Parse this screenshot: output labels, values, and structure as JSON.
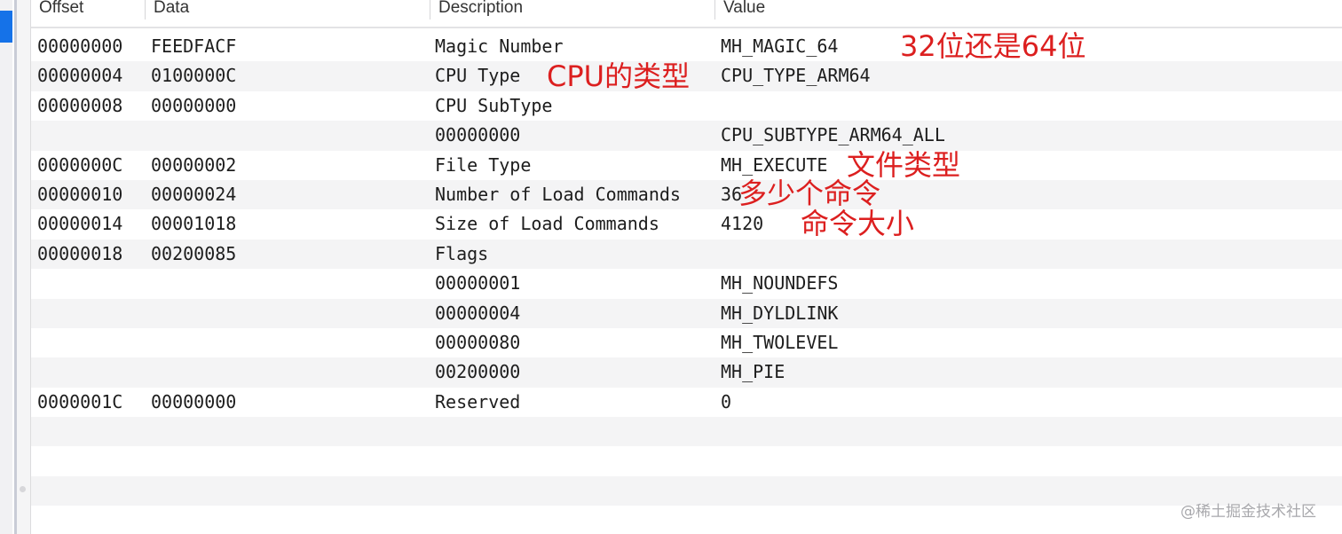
{
  "columns": {
    "offset": "Offset",
    "data": "Data",
    "description": "Description",
    "value": "Value"
  },
  "rows": [
    {
      "offset": "00000000",
      "data": "FEEDFACF",
      "description": "Magic Number",
      "value": "MH_MAGIC_64"
    },
    {
      "offset": "00000004",
      "data": "0100000C",
      "description": "CPU Type",
      "value": "CPU_TYPE_ARM64"
    },
    {
      "offset": "00000008",
      "data": "00000000",
      "description": "CPU SubType",
      "value": ""
    },
    {
      "offset": "",
      "data": "",
      "description": "00000000",
      "value": "CPU_SUBTYPE_ARM64_ALL"
    },
    {
      "offset": "0000000C",
      "data": "00000002",
      "description": "File Type",
      "value": "MH_EXECUTE"
    },
    {
      "offset": "00000010",
      "data": "00000024",
      "description": "Number of Load Commands",
      "value": "36"
    },
    {
      "offset": "00000014",
      "data": "00001018",
      "description": "Size of Load Commands",
      "value": "4120"
    },
    {
      "offset": "00000018",
      "data": "00200085",
      "description": "Flags",
      "value": ""
    },
    {
      "offset": "",
      "data": "",
      "description": "00000001",
      "value": "MH_NOUNDEFS"
    },
    {
      "offset": "",
      "data": "",
      "description": "00000004",
      "value": "MH_DYLDLINK"
    },
    {
      "offset": "",
      "data": "",
      "description": "00000080",
      "value": "MH_TWOLEVEL"
    },
    {
      "offset": "",
      "data": "",
      "description": "00200000",
      "value": "MH_PIE"
    },
    {
      "offset": "0000001C",
      "data": "00000000",
      "description": "Reserved",
      "value": "0"
    },
    {
      "offset": "",
      "data": "",
      "description": "",
      "value": ""
    },
    {
      "offset": "",
      "data": "",
      "description": "",
      "value": ""
    },
    {
      "offset": "",
      "data": "",
      "description": "",
      "value": ""
    },
    {
      "offset": "",
      "data": "",
      "description": "",
      "value": ""
    }
  ],
  "annotations": {
    "bits": "32位还是64位",
    "cpu_type": "CPU的类型",
    "file_type": "文件类型",
    "command_count": "多少个命令",
    "command_size": "命令大小"
  },
  "watermark": "@稀土掘金技术社区",
  "colors": {
    "annotation": "#dc1f1f",
    "selection_accent": "#1572e8",
    "alt_row": "#f4f4f5"
  }
}
